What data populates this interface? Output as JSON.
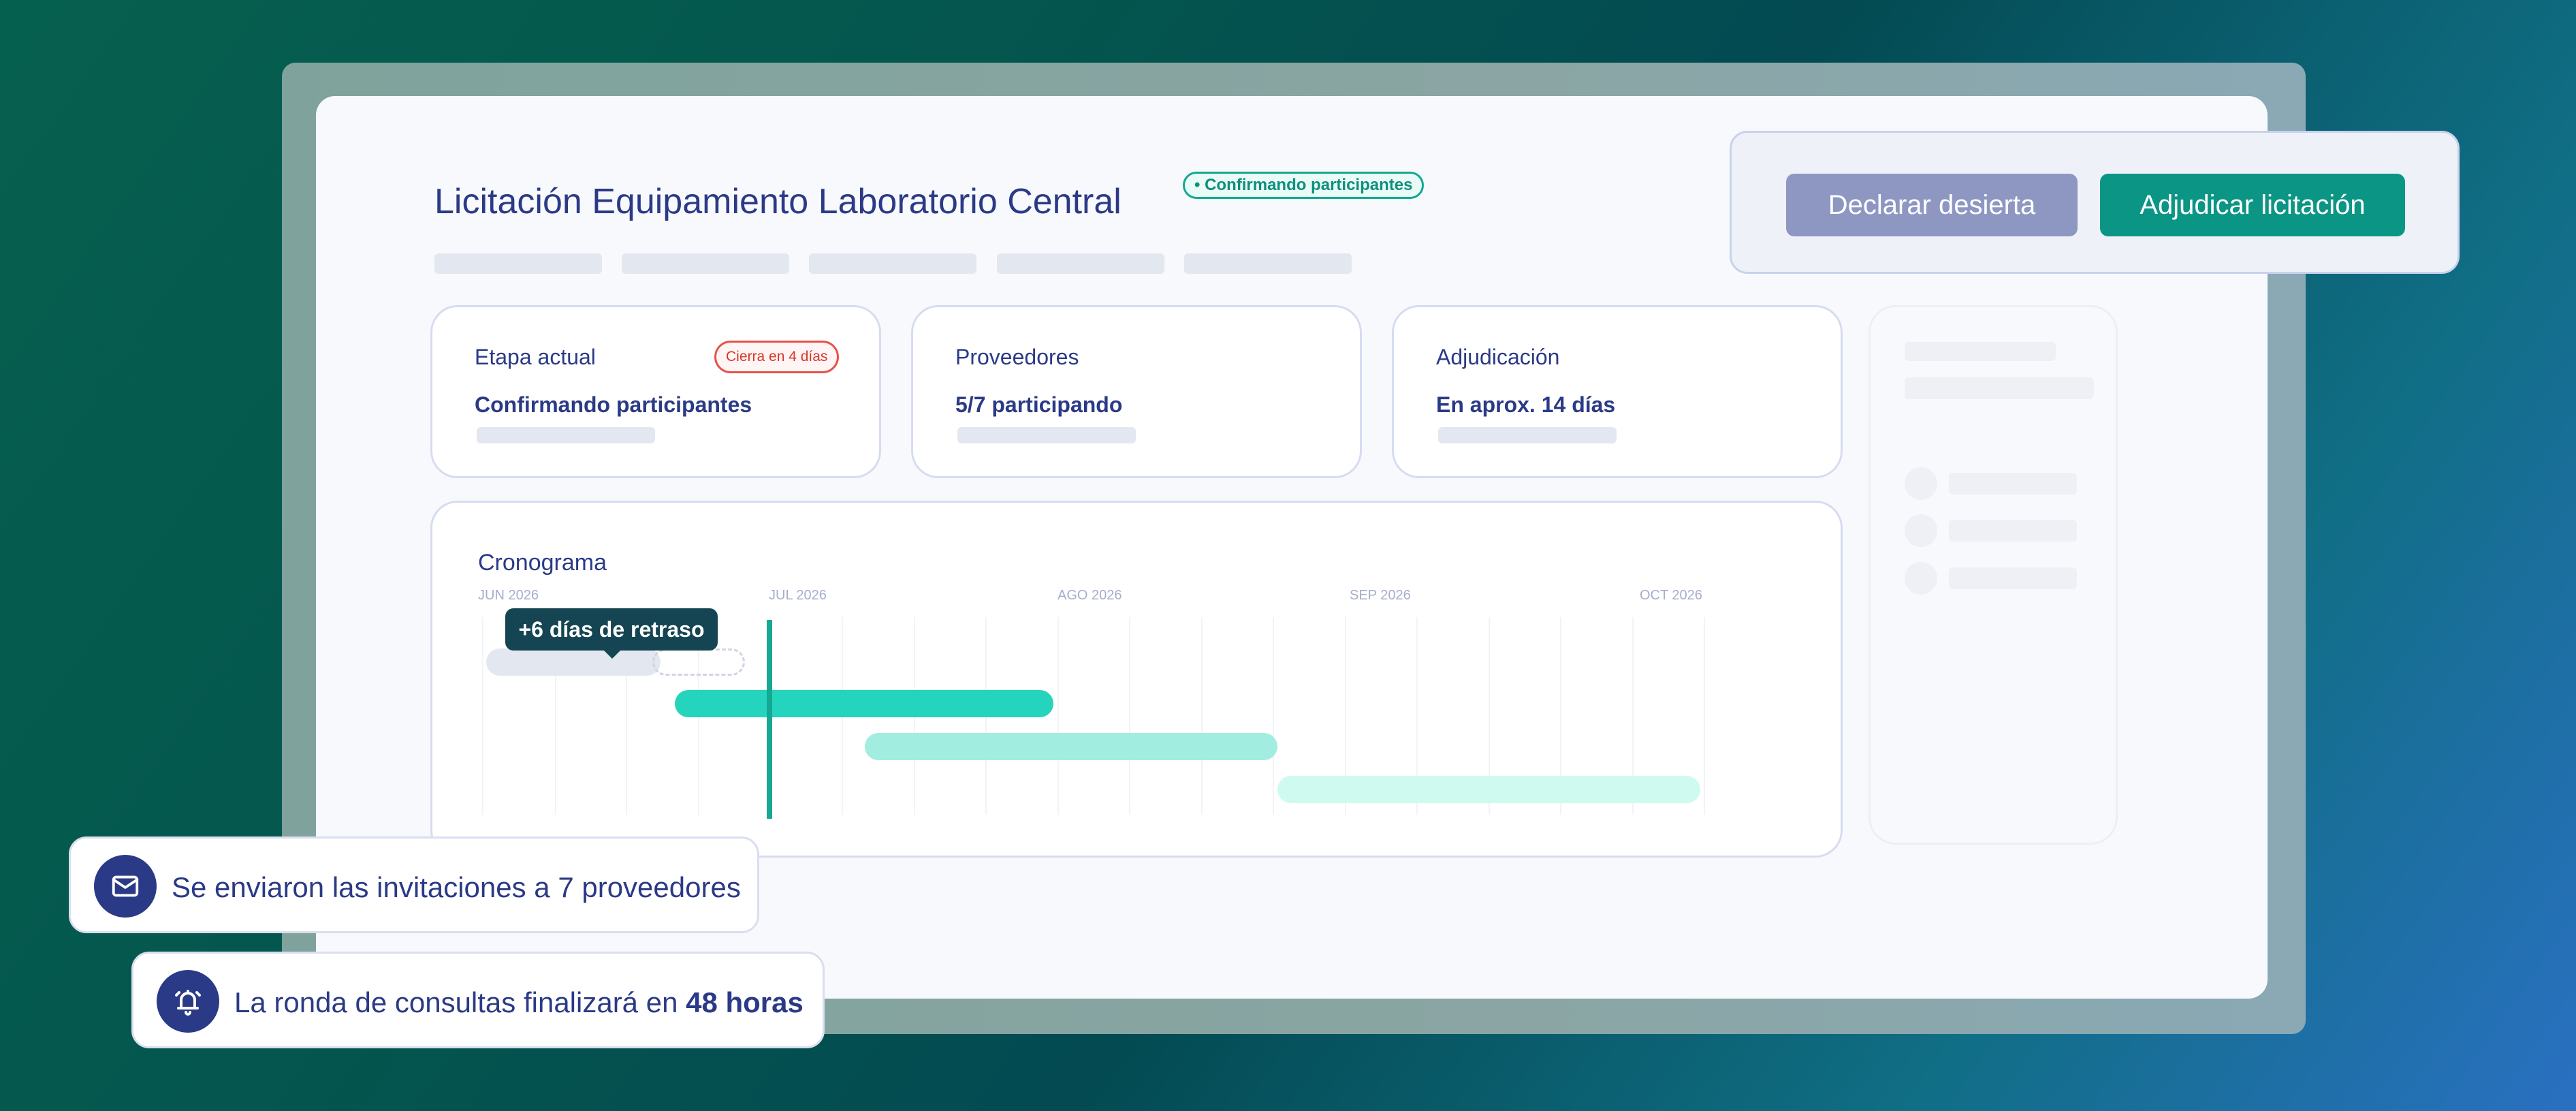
{
  "header": {
    "title": "Licitación Equipamiento Laboratorio Central",
    "status_badge": "• Confirmando participantes"
  },
  "actions": {
    "declare_deserted": "Declarar desierta",
    "award": "Adjudicar licitación"
  },
  "summary_cards": [
    {
      "label": "Etapa actual",
      "value": "Confirmando participantes",
      "badge": "Cierra en 4 días"
    },
    {
      "label": "Proveedores",
      "value": "5/7 participando"
    },
    {
      "label": "Adjudicación",
      "value": "En aprox. 14 días"
    }
  ],
  "timeline": {
    "title": "Cronograma",
    "months": [
      "JUN 2026",
      "JUL 2026",
      "AGO 2026",
      "SEP 2026",
      "OCT 2026"
    ],
    "delay_tooltip": "+6 días de retraso"
  },
  "colors": {
    "brand_navy": "#2b3a86",
    "accent_teal": "#0b9585",
    "alert_red": "#d7352c",
    "task_1": "#25d4bd",
    "task_2": "#a1ede0",
    "task_3": "#cffaf0"
  },
  "notifications": [
    {
      "icon": "envelope-icon",
      "text": "Se enviaron las invitaciones a 7 proveedores"
    },
    {
      "icon": "bell-ring-icon",
      "text_prefix": "La ronda de consultas finalizará en ",
      "text_bold": "48 horas"
    }
  ]
}
